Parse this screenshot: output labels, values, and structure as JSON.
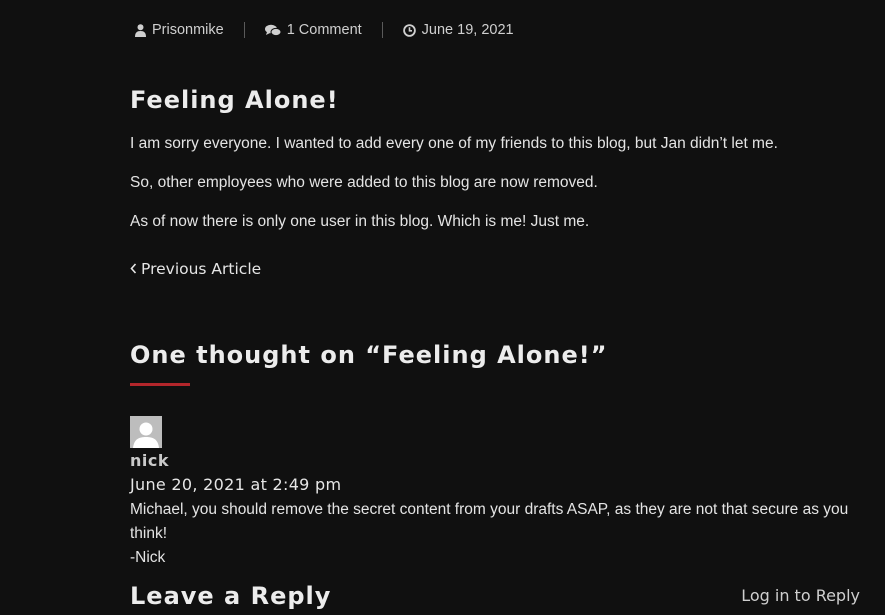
{
  "meta": {
    "author": "Prisonmike",
    "comments": "1 Comment",
    "date": "June 19, 2021",
    "icons": [
      "user-icon",
      "comments-icon",
      "clock-icon"
    ]
  },
  "post": {
    "title": "Feeling Alone!",
    "paragraphs": [
      "I am sorry everyone. I wanted to add every one of my friends to this blog, but Jan didn’t let me.",
      "So, other employees who were added to this blog are now removed.",
      "As of now there is only one user in this blog. Which is me! Just me."
    ]
  },
  "nav": {
    "prev_label": "Previous Article"
  },
  "comments": {
    "heading": "One thought on “Feeling Alone!”",
    "accent_color": "#b3262b",
    "items": [
      {
        "author": "nick",
        "date": "June 20, 2021 at 2:49 pm",
        "text": "Michael, you should remove the secret content from your drafts ASAP, as they are not that secure as you think!",
        "signature": "-Nick"
      }
    ]
  },
  "reply": {
    "heading": "Leave a Reply",
    "login_link": "Log in to Reply"
  }
}
